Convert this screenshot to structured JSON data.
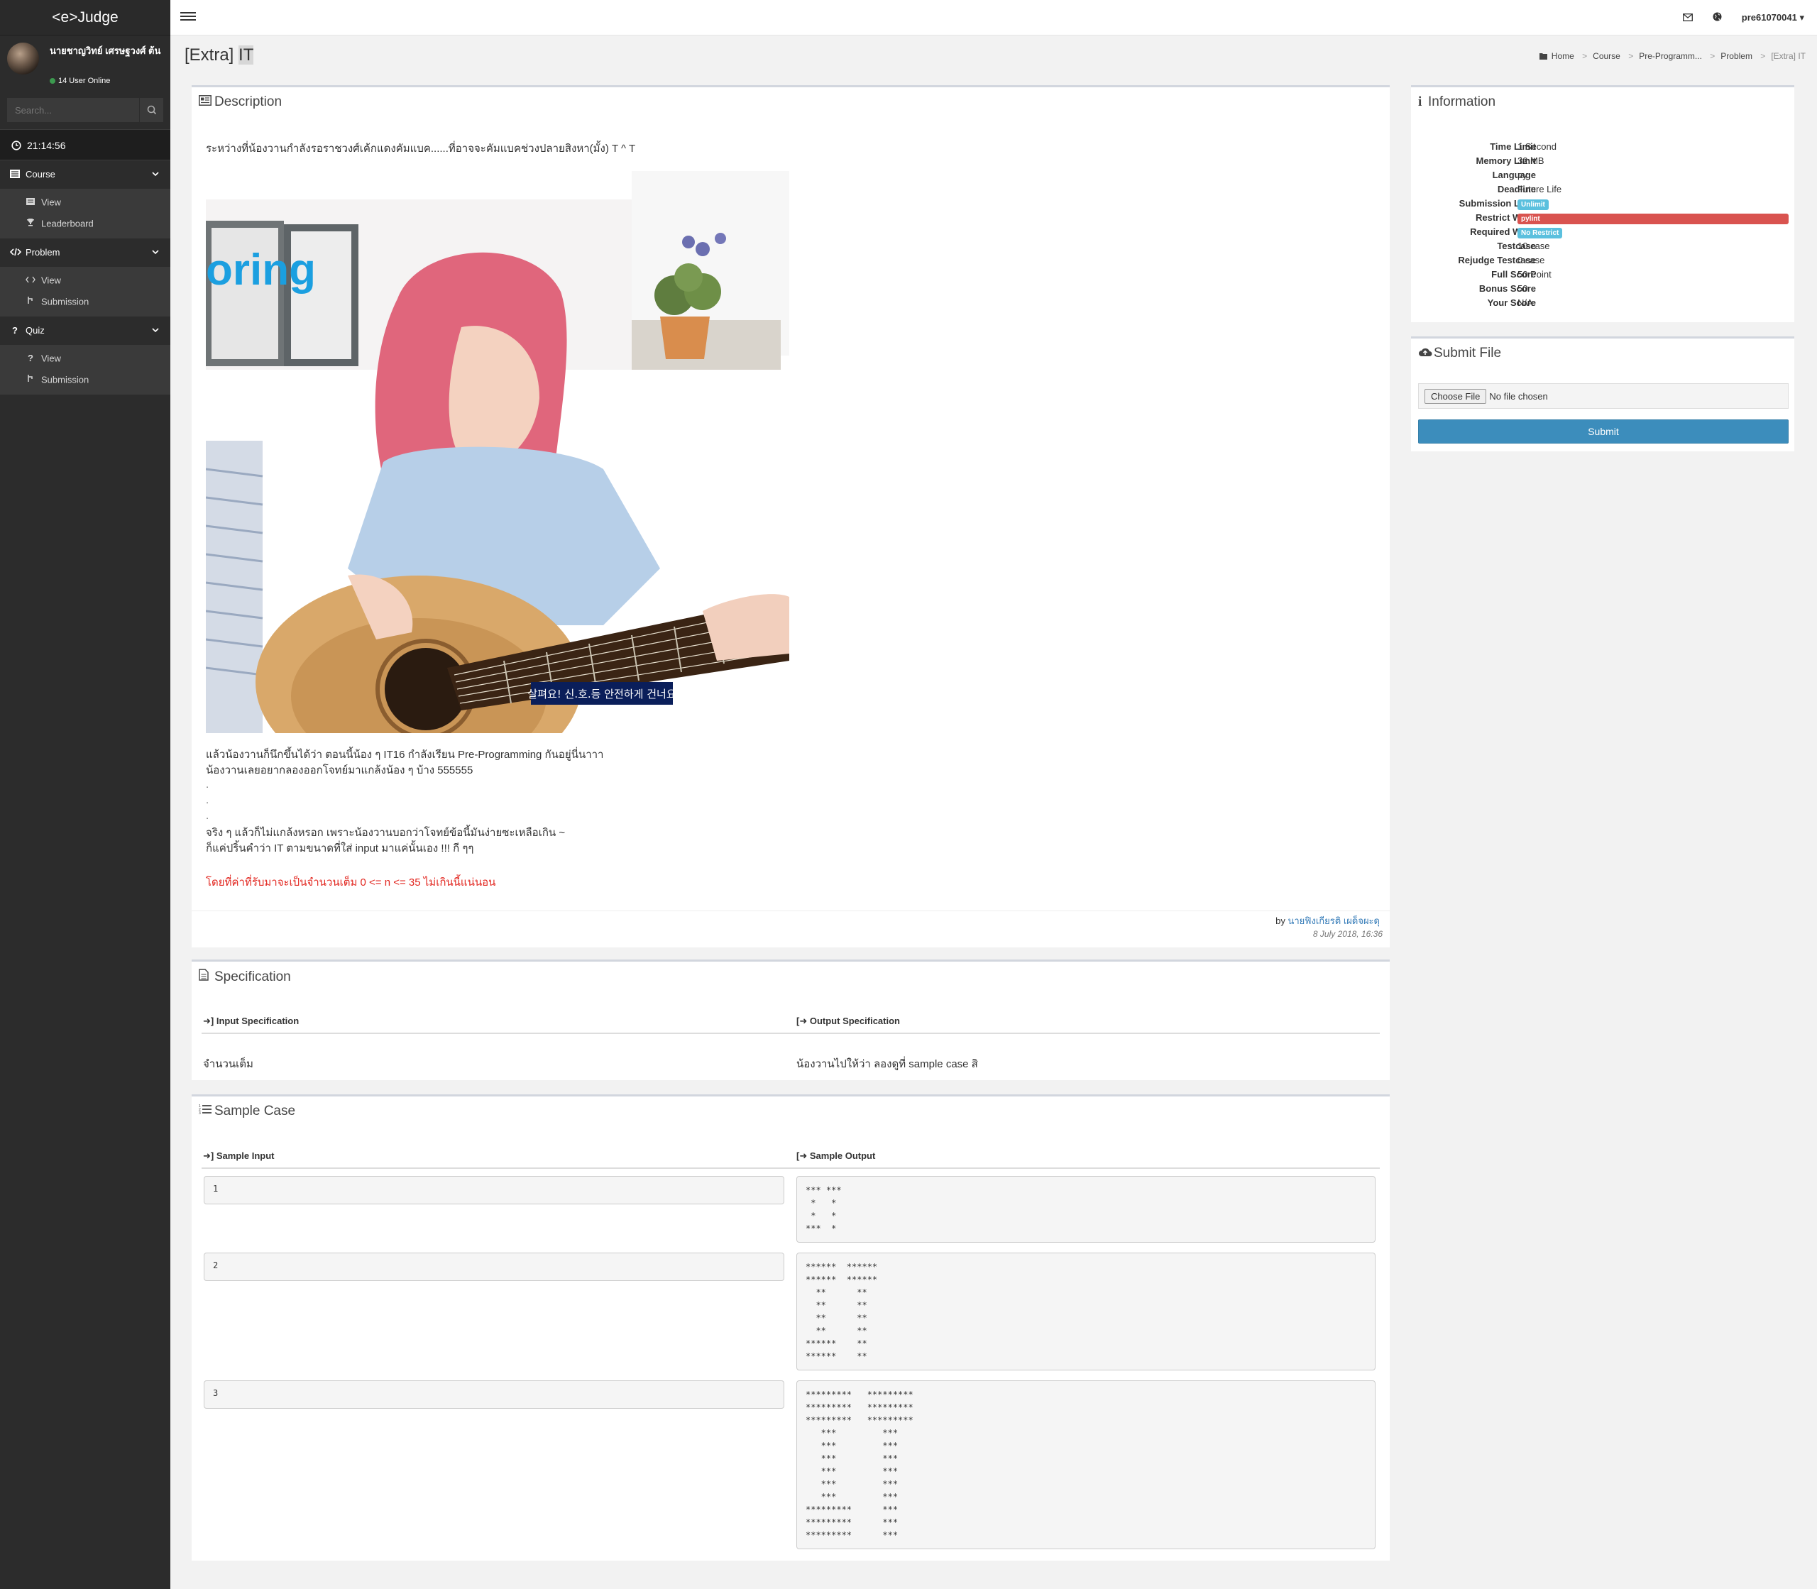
{
  "app": {
    "logo": "<e>Judge"
  },
  "user": {
    "name": "นายชาญวิทย์ เศรษฐวงศ์ ต้น",
    "online": "14 User Online",
    "top_username": "pre61070041"
  },
  "search": {
    "placeholder": "Search..."
  },
  "clock": "21:14:56",
  "sidebar": {
    "groups": [
      {
        "label": "Course",
        "items": [
          {
            "label": "View"
          },
          {
            "label": "Leaderboard"
          }
        ]
      },
      {
        "label": "Problem",
        "items": [
          {
            "label": "View"
          },
          {
            "label": "Submission"
          }
        ]
      },
      {
        "label": "Quiz",
        "items": [
          {
            "label": "View"
          },
          {
            "label": "Submission"
          }
        ]
      }
    ]
  },
  "page": {
    "title_prefix": "[Extra] ",
    "title_highlight": "IT"
  },
  "breadcrumb": {
    "home": "Home",
    "course": "Course",
    "pre": "Pre-Programm...",
    "problem": "Problem",
    "current": "[Extra] IT"
  },
  "description": {
    "title": "Description",
    "p1": "ระหว่างที่น้องวานกำลังรอราชวงศ์เค้กแดงคัมแบค......ที่อาจจะคัมแบคช่วงปลายสิงหา(มั้ง)  T ^ T",
    "image_text": "oring",
    "image_caption": "살펴요! 신.호.등 안전하게 건너요",
    "p2a": "แล้วน้องวานก็นึกขึ้นได้ว่า ตอนนี้น้อง ๆ IT16  กำลังเรียน Pre-Programming กันอยู่นี่นาาา",
    "p2b": "น้องวานเลยอยากลองออกโจทย์มาแกล้งน้อง ๆ บ้าง 555555",
    "dots": [
      ".",
      ".",
      "."
    ],
    "p3a": "จริง ๆ แล้วก็ไม่แกล้งหรอก  เพราะน้องวานบอกว่าโจทย์ข้อนี้มันง่ายซะเหลือเกิน ~",
    "p3b": "ก็แค่ปริ้นคำว่า IT ตามขนาดที่ใส่ input มาแค่นั้นเอง !!!  กี ๆๆ",
    "red": "โดยที่ค่าที่รับมาจะเป็นจำนวนเต็ม 0 <= n <= 35 ไม่เกินนี้แน่นอน",
    "by": "by ",
    "author": "นายฟิงเกียรติ เผด็จผะดุ",
    "date": "8 July 2018, 16:36"
  },
  "specification": {
    "title": "Specification",
    "input_head": "Input Specification",
    "output_head": "Output Specification",
    "input_text": "จำนวนเต็ม",
    "output_text": "น้องวานไปให้ว่า ลองดูที่ sample case สิ"
  },
  "sample": {
    "title": "Sample Case",
    "input_head": "Sample Input",
    "output_head": "Sample Output",
    "cases": [
      {
        "input": "1",
        "output": "*** ***\n *   *\n *   *\n***  *"
      },
      {
        "input": "2",
        "output": "******  ******\n******  ******\n  **      **\n  **      **\n  **      **\n  **      **\n******    **\n******    **"
      },
      {
        "input": "3",
        "output": "*********   *********\n*********   *********\n*********   *********\n   ***         ***\n   ***         ***\n   ***         ***\n   ***         ***\n   ***         ***\n   ***         ***\n*********      ***\n*********      ***\n*********      ***"
      }
    ]
  },
  "information": {
    "title": "Information",
    "rows": [
      {
        "label": "Time Limit",
        "value": "1 Second"
      },
      {
        "label": "Memory Limit",
        "value": "32 MB"
      },
      {
        "label": "Language",
        "value": "py"
      },
      {
        "label": "Deadline",
        "value": "Future Life"
      },
      {
        "label": "Submission Limit",
        "badge": "Unlimit",
        "badge_color": "#5bc0de"
      },
      {
        "label": "Restrict Word",
        "badge": "pylint",
        "badge_color": "#d9534f"
      },
      {
        "label": "Required Word",
        "badge": "No Restrict",
        "badge_color": "#5bc0de"
      },
      {
        "label": "Testcase",
        "value": "10 case"
      },
      {
        "label": "Rejudge Testcase",
        "value": "0 case"
      },
      {
        "label": "Full Score",
        "value": "50 Point"
      },
      {
        "label": "Bonus Score",
        "value": "50"
      },
      {
        "label": "Your Score",
        "value": "N/A"
      }
    ]
  },
  "submit": {
    "title": "Submit File",
    "choose": "Choose File",
    "no_file": "No file chosen",
    "button": "Submit"
  }
}
